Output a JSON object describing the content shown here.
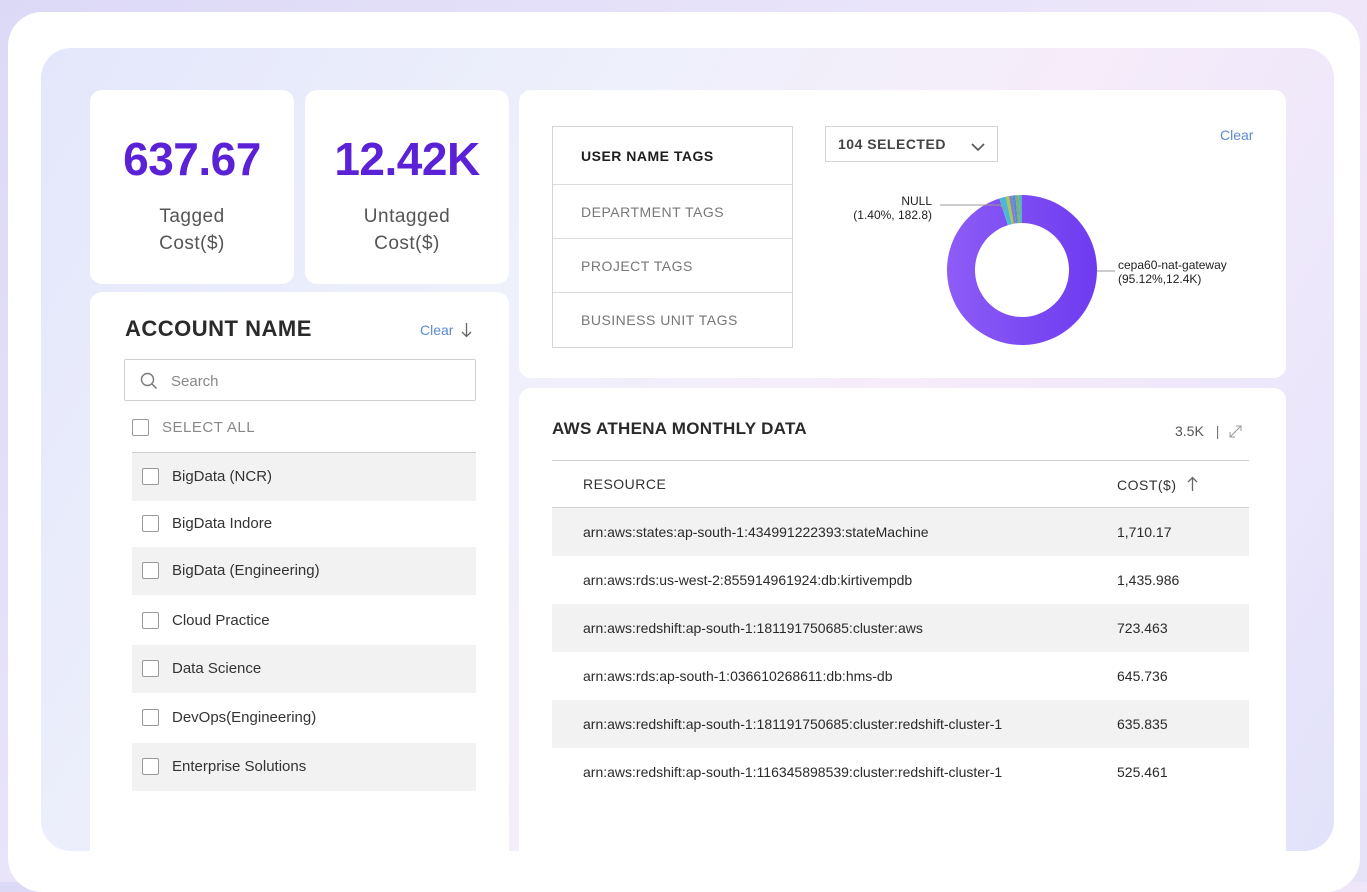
{
  "kpis": {
    "tagged": {
      "value": "637.67",
      "label_line1": "Tagged",
      "label_line2": "Cost($)"
    },
    "untagged": {
      "value": "12.42K",
      "label_line1": "Untagged",
      "label_line2": "Cost($)"
    }
  },
  "account_panel": {
    "title": "ACCOUNT NAME",
    "clear_label": "Clear",
    "sort_icon": "arrow-down-icon",
    "search_placeholder": "Search",
    "select_all_label": "SELECT ALL",
    "items": [
      "BigData (NCR)",
      "BigData Indore",
      "BigData (Engineering)",
      "Cloud Practice",
      "Data Science",
      "DevOps(Engineering)",
      "Enterprise Solutions"
    ]
  },
  "tags_panel": {
    "tabs": [
      "USER NAME TAGS",
      "DEPARTMENT TAGS",
      "PROJECT TAGS",
      "BUSINESS UNIT TAGS"
    ],
    "active_tab": "USER NAME TAGS",
    "dropdown_label": "104 SELECTED",
    "clear_label": "Clear"
  },
  "chart_data": {
    "type": "pie",
    "variant": "donut",
    "slices": [
      {
        "name": "cepa60-nat-gateway",
        "label_line1": "cepa60-nat-gateway",
        "label_line2": "(95.12%,12.4K)",
        "percent": 95.12,
        "color": "#6e3bf0"
      },
      {
        "name": "NULL",
        "label_line1": "NULL",
        "label_line2": "(1.40%, 182.8)",
        "percent": 1.4,
        "color": "#4cb8d4"
      }
    ],
    "other_slice_colors": [
      "#a7c957",
      "#8e7cc3",
      "#4a90e2",
      "#7fb069",
      "#5ab0c8"
    ]
  },
  "athena_table": {
    "title": "AWS ATHENA MONTHLY DATA",
    "total": "3.5K",
    "divider": "|",
    "expand_icon": "expand-icon",
    "columns": [
      "RESOURCE",
      "COST($)"
    ],
    "sort_icon": "arrow-up-icon",
    "rows": [
      {
        "resource": "arn:aws:states:ap-south-1:434991222393:stateMachine",
        "cost": "1,710.17"
      },
      {
        "resource": "arn:aws:rds:us-west-2:855914961924:db:kirtivempdb",
        "cost": "1,435.986"
      },
      {
        "resource": "arn:aws:redshift:ap-south-1:181191750685:cluster:aws",
        "cost": "723.463"
      },
      {
        "resource": "arn:aws:rds:ap-south-1:036610268611:db:hms-db",
        "cost": "645.736"
      },
      {
        "resource": "arn:aws:redshift:ap-south-1:181191750685:cluster:redshift-cluster-1",
        "cost": "635.835"
      },
      {
        "resource": "arn:aws:redshift:ap-south-1:116345898539:cluster:redshift-cluster-1",
        "cost": "525.461"
      }
    ]
  },
  "colors": {
    "accent": "#5b21d6",
    "link": "#5b8bd0",
    "donut_main": "#6e3bf0"
  }
}
